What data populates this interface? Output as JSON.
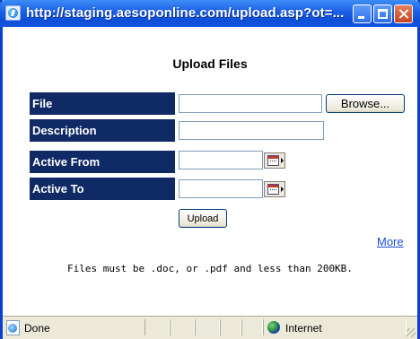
{
  "window": {
    "title": "http://staging.aesoponline.com/upload.asp?ot=...",
    "controls": {
      "minimize_icon": "minimize-icon",
      "maximize_icon": "maximize-icon",
      "close_icon": "close-icon"
    }
  },
  "form": {
    "heading": "Upload Files",
    "fields": {
      "file": {
        "label": "File",
        "value": "",
        "browse_label": "Browse..."
      },
      "description": {
        "label": "Description",
        "value": ""
      },
      "active_from": {
        "label": "Active From",
        "value": "",
        "picker_icon": "calendar-icon"
      },
      "active_to": {
        "label": "Active To",
        "value": "",
        "picker_icon": "calendar-icon"
      }
    },
    "upload_label": "Upload",
    "more_link": "More",
    "note": "Files must be .doc, or .pdf and less than 200KB."
  },
  "statusbar": {
    "status_text": "Done",
    "zone_text": "Internet",
    "status_icon": "ie-page-icon",
    "zone_icon": "globe-icon"
  },
  "colors": {
    "title_bar": "#0f4fd6",
    "label_bg": "#102a66",
    "label_text": "#ffffff",
    "link": "#1f4bd8",
    "close_button": "#c5421f"
  }
}
